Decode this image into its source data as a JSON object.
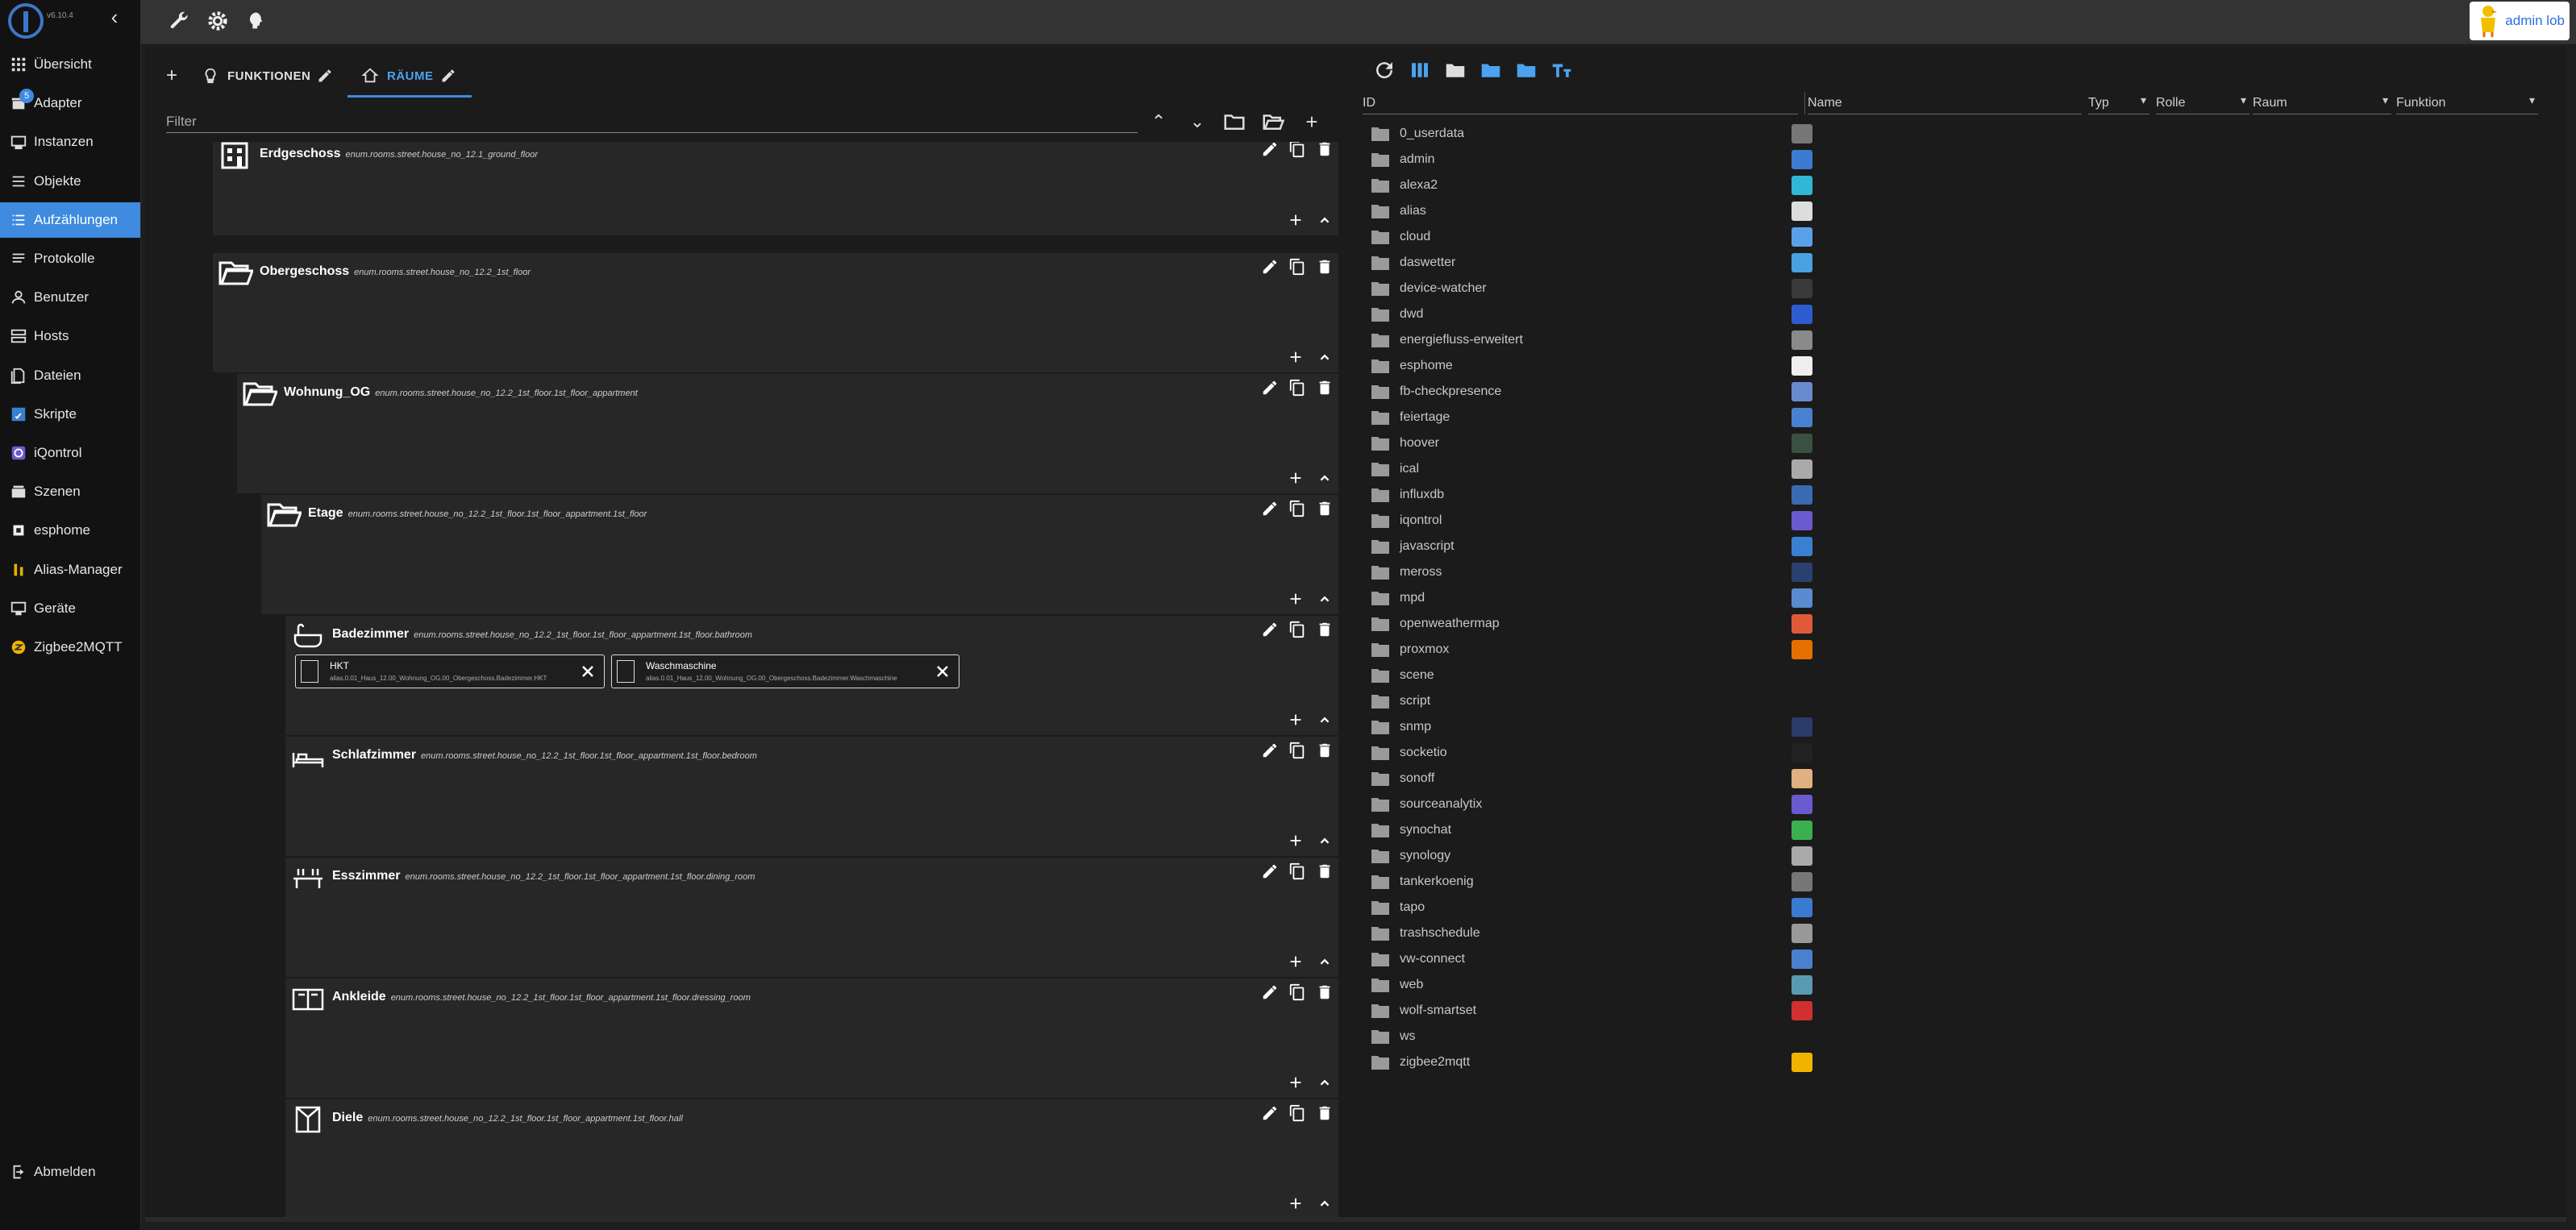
{
  "app": {
    "version": "v6.10.4",
    "title": "ioBroker admin"
  },
  "sidebar": {
    "items": [
      {
        "label": "Übersicht",
        "icon": "grid-icon",
        "active": false
      },
      {
        "label": "Adapter",
        "icon": "store-icon",
        "active": false,
        "badge": "5"
      },
      {
        "label": "Instanzen",
        "icon": "instances-icon",
        "active": false
      },
      {
        "label": "Objekte",
        "icon": "list-icon",
        "active": false
      },
      {
        "label": "Aufzählungen",
        "icon": "enum-list-icon",
        "active": true
      },
      {
        "label": "Protokolle",
        "icon": "log-icon",
        "active": false
      },
      {
        "label": "Benutzer",
        "icon": "user-icon",
        "active": false
      },
      {
        "label": "Hosts",
        "icon": "hosts-icon",
        "active": false
      },
      {
        "label": "Dateien",
        "icon": "files-icon",
        "active": false
      },
      {
        "label": "Skripte",
        "icon": "scripts-icon",
        "active": false
      },
      {
        "label": "iQontrol",
        "icon": "iqontrol-icon",
        "active": false
      },
      {
        "label": "Szenen",
        "icon": "scenes-icon",
        "active": false
      },
      {
        "label": "esphome",
        "icon": "esphome-icon",
        "active": false
      },
      {
        "label": "Alias-Manager",
        "icon": "alias-icon",
        "active": false
      },
      {
        "label": "Geräte",
        "icon": "devices-icon",
        "active": false
      },
      {
        "label": "Zigbee2MQTT",
        "icon": "zigbee-icon",
        "active": false
      }
    ],
    "logout_label": "Abmelden"
  },
  "topbar": {
    "user_label": "admin lob"
  },
  "enums": {
    "tabs": [
      {
        "label": "FUNKTIONEN",
        "icon": "lightbulb-icon"
      },
      {
        "label": "RÄUME",
        "icon": "home-icon"
      }
    ],
    "filter_placeholder": "Filter",
    "items": [
      {
        "name": "Erdgeschoss",
        "id": "enum.rooms.street.house_no_12.1_ground_floor",
        "icon": "building-icon"
      },
      {
        "name": "Obergeschoss",
        "id": "enum.rooms.street.house_no_12.2_1st_floor",
        "icon": "folder-open-icon"
      },
      {
        "name": "Wohnung_OG",
        "id": "enum.rooms.street.house_no_12.2_1st_floor.1st_floor_appartment",
        "icon": "folder-open-icon"
      },
      {
        "name": "Etage",
        "id": "enum.rooms.street.house_no_12.2_1st_floor.1st_floor_appartment.1st_floor",
        "icon": "folder-open-icon"
      },
      {
        "name": "Badezimmer",
        "id": "enum.rooms.street.house_no_12.2_1st_floor.1st_floor_appartment.1st_floor.bathroom",
        "icon": "bathtub-icon",
        "members": [
          {
            "name": "HKT",
            "id": "alias.0.01_Haus_12.00_Wohnung_OG.00_Obergeschoss.Badezimmer.HKT"
          },
          {
            "name": "Waschmaschine",
            "id": "alias.0.01_Haus_12.00_Wohnung_OG.00_Obergeschoss.Badezimmer.Waschmaschine"
          }
        ]
      },
      {
        "name": "Schlafzimmer",
        "id": "enum.rooms.street.house_no_12.2_1st_floor.1st_floor_appartment.1st_floor.bedroom",
        "icon": "bed-icon"
      },
      {
        "name": "Esszimmer",
        "id": "enum.rooms.street.house_no_12.2_1st_floor.1st_floor_appartment.1st_floor.dining_room",
        "icon": "dining-icon"
      },
      {
        "name": "Ankleide",
        "id": "enum.rooms.street.house_no_12.2_1st_floor.1st_floor_appartment.1st_floor.dressing_room",
        "icon": "wardrobe-icon"
      },
      {
        "name": "Diele",
        "id": "enum.rooms.street.house_no_12.2_1st_floor.1st_floor_appartment.1st_floor.hall",
        "icon": "hall-icon"
      }
    ]
  },
  "objects": {
    "columns": {
      "id": "ID",
      "name": "Name",
      "type": "Typ",
      "role": "Rolle",
      "room": "Raum",
      "function": "Funktion"
    },
    "rows": [
      {
        "id": "0_userdata",
        "icon_color": "#777777"
      },
      {
        "id": "admin",
        "icon_color": "#3b7bd0"
      },
      {
        "id": "alexa2",
        "icon_color": "#31b7d6"
      },
      {
        "id": "alias",
        "icon_color": "#dddddd"
      },
      {
        "id": "cloud",
        "icon_color": "#5aa0e8"
      },
      {
        "id": "daswetter",
        "icon_color": "#4aa0e0"
      },
      {
        "id": "device-watcher",
        "icon_color": "#3a3a3a"
      },
      {
        "id": "dwd",
        "icon_color": "#2f5bd0"
      },
      {
        "id": "energiefluss-erweitert",
        "icon_color": "#8a8a8a"
      },
      {
        "id": "esphome",
        "icon_color": "#eeeeee"
      },
      {
        "id": "fb-checkpresence",
        "icon_color": "#6a8ad0"
      },
      {
        "id": "feiertage",
        "icon_color": "#4a80d0"
      },
      {
        "id": "hoover",
        "icon_color": "#3a5040"
      },
      {
        "id": "ical",
        "icon_color": "#aaaaaa"
      },
      {
        "id": "influxdb",
        "icon_color": "#3a6ab0"
      },
      {
        "id": "iqontrol",
        "icon_color": "#6a5acd"
      },
      {
        "id": "javascript",
        "icon_color": "#3a80d0"
      },
      {
        "id": "meross",
        "icon_color": "#2a4070"
      },
      {
        "id": "mpd",
        "icon_color": "#5a8ad0"
      },
      {
        "id": "openweathermap",
        "icon_color": "#e05a3a"
      },
      {
        "id": "proxmox",
        "icon_color": "#e57000"
      },
      {
        "id": "scene",
        "icon_color": "#1b1b1b"
      },
      {
        "id": "script",
        "icon_color": "#1b1b1b"
      },
      {
        "id": "snmp",
        "icon_color": "#2a3a6a"
      },
      {
        "id": "socketio",
        "icon_color": "#222222"
      },
      {
        "id": "sonoff",
        "icon_color": "#e0b080"
      },
      {
        "id": "sourceanalytix",
        "icon_color": "#6a5acd"
      },
      {
        "id": "synochat",
        "icon_color": "#3ab050"
      },
      {
        "id": "synology",
        "icon_color": "#aaaaaa"
      },
      {
        "id": "tankerkoenig",
        "icon_color": "#777777"
      },
      {
        "id": "tapo",
        "icon_color": "#3a7ad0"
      },
      {
        "id": "trashschedule",
        "icon_color": "#999999"
      },
      {
        "id": "vw-connect",
        "icon_color": "#4a80d0"
      },
      {
        "id": "web",
        "icon_color": "#5a9ab0"
      },
      {
        "id": "wolf-smartset",
        "icon_color": "#d03030"
      },
      {
        "id": "ws",
        "icon_color": "#1b1b1b"
      },
      {
        "id": "zigbee2mqtt",
        "icon_color": "#f0b400"
      }
    ]
  },
  "colors": {
    "accent": "#3e8be0",
    "sidebar_bg": "#121212",
    "card_bg": "#272727",
    "topbar_bg": "#333333"
  }
}
